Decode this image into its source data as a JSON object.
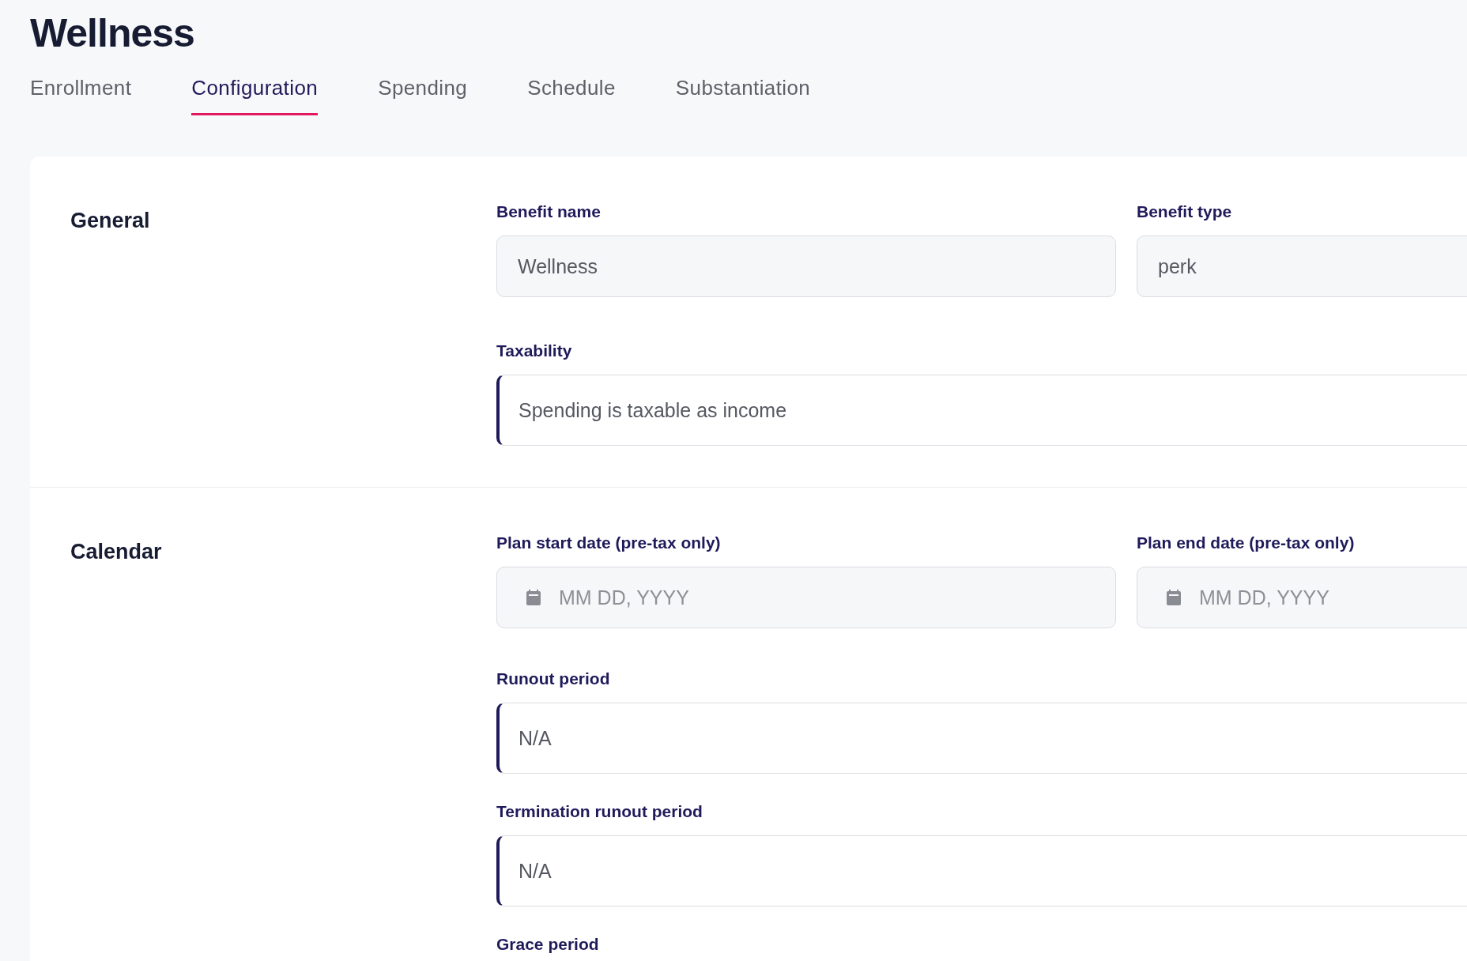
{
  "page": {
    "title": "Wellness"
  },
  "tabs": [
    {
      "label": "Enrollment",
      "selected": false
    },
    {
      "label": "Configuration",
      "selected": true
    },
    {
      "label": "Spending",
      "selected": false
    },
    {
      "label": "Schedule",
      "selected": false
    },
    {
      "label": "Substantiation",
      "selected": false
    }
  ],
  "sections": [
    {
      "title": "General",
      "rows": [
        [
          {
            "kind": "text",
            "label": "Benefit name",
            "value": "Wellness"
          },
          {
            "kind": "text",
            "label": "Benefit type",
            "value": "perk"
          }
        ],
        [
          {
            "kind": "select",
            "label": "Taxability",
            "value": "Spending is taxable as income"
          }
        ]
      ]
    },
    {
      "title": "Calendar",
      "rows": [
        [
          {
            "kind": "date",
            "label": "Plan start date (pre-tax only)",
            "placeholder": "MM DD, YYYY"
          },
          {
            "kind": "date",
            "label": "Plan end date (pre-tax only)",
            "placeholder": "MM DD, YYYY"
          }
        ],
        [
          {
            "kind": "select",
            "label": "Runout period",
            "value": "N/A"
          }
        ],
        [
          {
            "kind": "select",
            "label": "Termination runout period",
            "value": "N/A"
          }
        ],
        [
          {
            "kind": "select",
            "label": "Grace period"
          }
        ]
      ]
    }
  ]
}
